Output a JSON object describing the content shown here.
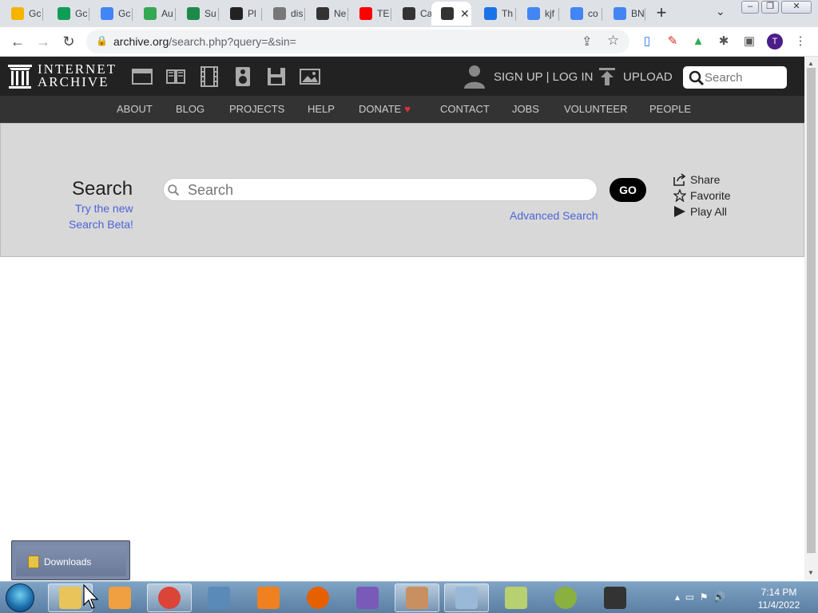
{
  "browser": {
    "tabs": [
      {
        "title": "Gc",
        "icon": "google-slides-icon",
        "color": "#f4b400"
      },
      {
        "title": "Gc",
        "icon": "google-sheets-icon",
        "color": "#0f9d58"
      },
      {
        "title": "Gc",
        "icon": "google-docs-icon",
        "color": "#4285f4"
      },
      {
        "title": "Au",
        "icon": "google-drive-icon",
        "color": "#34a853"
      },
      {
        "title": "Su",
        "icon": "bird-icon",
        "color": "#1c8a4a"
      },
      {
        "title": "Pl",
        "icon": "ea-icon",
        "color": "#222222"
      },
      {
        "title": "dis",
        "icon": "globe-icon",
        "color": "#777777"
      },
      {
        "title": "Ne",
        "icon": "github-icon",
        "color": "#333333"
      },
      {
        "title": "TE",
        "icon": "youtube-icon",
        "color": "#ff0000"
      },
      {
        "title": "Ca",
        "icon": "archive-icon",
        "color": "#333333"
      },
      {
        "title": "",
        "icon": "archive-icon",
        "color": "#333333",
        "active": true
      },
      {
        "title": "Th",
        "icon": "lightning-icon",
        "color": "#1a73e8"
      },
      {
        "title": "kjf",
        "icon": "google-icon",
        "color": "#4285f4"
      },
      {
        "title": "co",
        "icon": "google-icon",
        "color": "#4285f4"
      },
      {
        "title": "BN",
        "icon": "google-icon",
        "color": "#4285f4"
      }
    ],
    "url_host": "archive.org",
    "url_path": "/search.php?query=&sin=",
    "profile_initial": "T"
  },
  "ia": {
    "logo_line1": "INTERNET",
    "logo_line2": "ARCHIVE",
    "signup": "SIGN UP | LOG IN",
    "upload": "UPLOAD",
    "search_placeholder": "Search",
    "nav": [
      "ABOUT",
      "BLOG",
      "PROJECTS",
      "HELP",
      "DONATE",
      "CONTACT",
      "JOBS",
      "VOLUNTEER",
      "PEOPLE"
    ]
  },
  "search_panel": {
    "title": "Search",
    "beta_line1": "Try the new",
    "beta_line2": "Search Beta!",
    "input_placeholder": "Search",
    "go_label": "GO",
    "advanced": "Advanced Search",
    "share": "Share",
    "favorite": "Favorite",
    "play_all": "Play All"
  },
  "downloads_popup": {
    "label": "Downloads"
  },
  "taskbar": {
    "clock_time": "7:14 PM",
    "clock_date": "11/4/2022",
    "apps": [
      "file-explorer-icon",
      "media-player-icon",
      "chrome-icon",
      "network-icon",
      "vlc-icon",
      "firefox-icon",
      "pidgin-icon",
      "paint-icon",
      "notepad-icon",
      "map-icon",
      "play-icon",
      "camcorder-icon"
    ]
  },
  "colors": {
    "ia_dark": "#222222",
    "ia_nav": "#333333",
    "link_blue": "#4b64d8",
    "heart": "#e0313b"
  }
}
